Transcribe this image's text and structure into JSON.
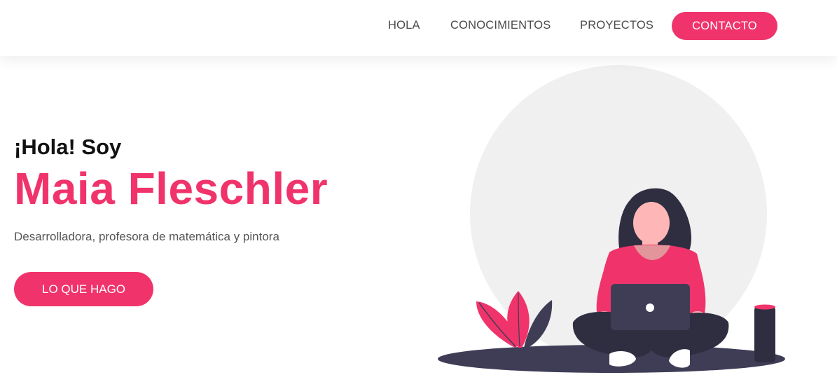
{
  "nav": {
    "items": [
      {
        "label": "HOLA"
      },
      {
        "label": "CONOCIMIENTOS"
      },
      {
        "label": "PROYECTOS"
      }
    ],
    "contact_label": "CONTACTO"
  },
  "hero": {
    "greeting": "¡Hola! Soy",
    "name": "Maia Fleschler",
    "subtitle": "Desarrolladora, profesora de matemática y pintora",
    "cta_label": "LO QUE HAGO"
  },
  "colors": {
    "accent": "#f0346b",
    "dark": "#3f3d56",
    "circle": "#f0f0f0"
  },
  "illustration": {
    "icons": [
      "woman-with-laptop-icon",
      "plant-icon",
      "smart-speaker-icon"
    ]
  }
}
